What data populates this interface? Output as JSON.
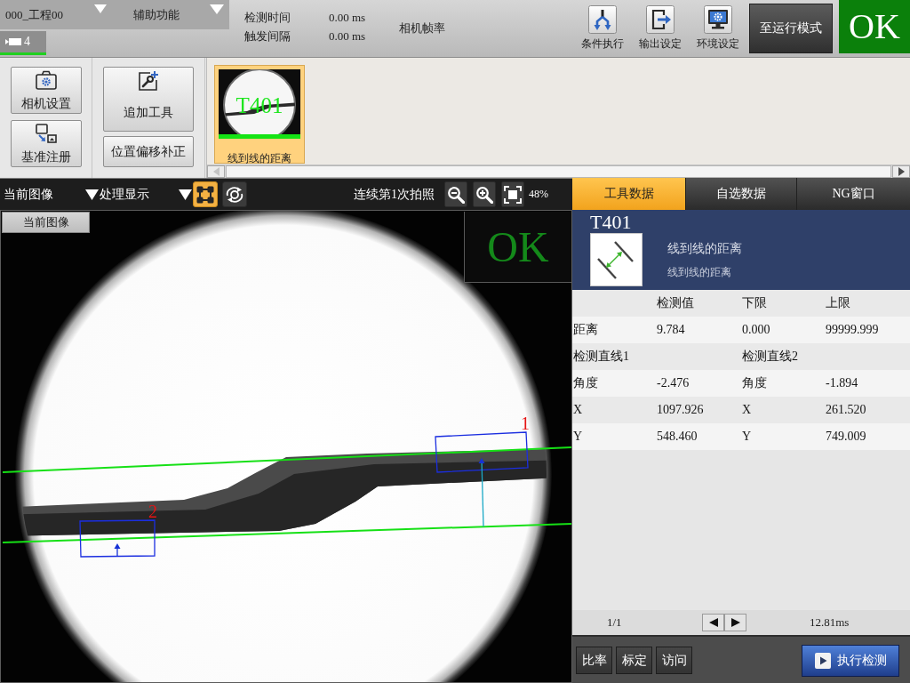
{
  "top_bar": {
    "project": "000_工程00",
    "menu": "辅助功能",
    "camera_tab": {
      "label": "4",
      "selected": true
    },
    "stats": [
      {
        "label": "检测时间",
        "value": "0.00 ms"
      },
      {
        "label": "触发间隔",
        "value": "0.00 ms"
      }
    ],
    "frame_rate_label": "相机帧率",
    "actions": [
      {
        "kind": "branch",
        "label": "条件执行"
      },
      {
        "kind": "output",
        "label": "输出设定"
      },
      {
        "kind": "environment",
        "label": "环境设定"
      }
    ],
    "mode_button": "至运行模式",
    "result": "OK"
  },
  "toolbar": {
    "setup_buttons": [
      {
        "kind": "camera",
        "label": "相机设置"
      },
      {
        "kind": "reference",
        "label": "基准注册"
      }
    ],
    "tool_buttons": [
      {
        "kind": "add",
        "label": "追加工具"
      },
      {
        "kind": "offset",
        "label": "位置偏移补正"
      }
    ],
    "tools": [
      {
        "code": "T401",
        "name": "线到线的距离",
        "selected": true
      }
    ]
  },
  "image_toolbar": {
    "source": "当前图像",
    "display": "处理显示",
    "view_buttons": [
      {
        "kind": "overlay",
        "on": true
      },
      {
        "kind": "cycle",
        "on": false
      }
    ],
    "capture_status": "连续第1次拍照",
    "zoom": "48%"
  },
  "viewer": {
    "label": "当前图像",
    "result": "OK",
    "regions": [
      {
        "number": "1"
      },
      {
        "number": "2"
      }
    ]
  },
  "panel_tabs": [
    {
      "label": "工具数据",
      "selected": true
    },
    {
      "label": "自选数据",
      "selected": false
    },
    {
      "label": "NG窗口",
      "selected": false
    }
  ],
  "tool_info": {
    "code": "T401",
    "title": "线到线的距离",
    "subtitle": "线到线的距离"
  },
  "table": {
    "columns": [
      "检测值",
      "下限",
      "上限"
    ],
    "rows": [
      {
        "kind": "limits",
        "label": "距离",
        "value": "9.784",
        "lower": "0.000",
        "upper": "99999.999"
      },
      {
        "kind": "group",
        "left": "检测直线1",
        "right": "检测直线2"
      },
      {
        "kind": "pair",
        "left_label": "角度",
        "left_value": "-2.476",
        "right_label": "角度",
        "right_value": "-1.894"
      },
      {
        "kind": "pair",
        "left_label": "X",
        "left_value": "1097.926",
        "right_label": "X",
        "right_value": "261.520"
      },
      {
        "kind": "pair",
        "left_label": "Y",
        "left_value": "548.460",
        "right_label": "Y",
        "right_value": "749.009"
      }
    ]
  },
  "pager": {
    "page": "1/1",
    "time": "12.81ms"
  },
  "bottom_buttons": [
    {
      "label": "比率"
    },
    {
      "label": "标定"
    },
    {
      "label": "访问"
    }
  ],
  "run_button": "执行检测"
}
